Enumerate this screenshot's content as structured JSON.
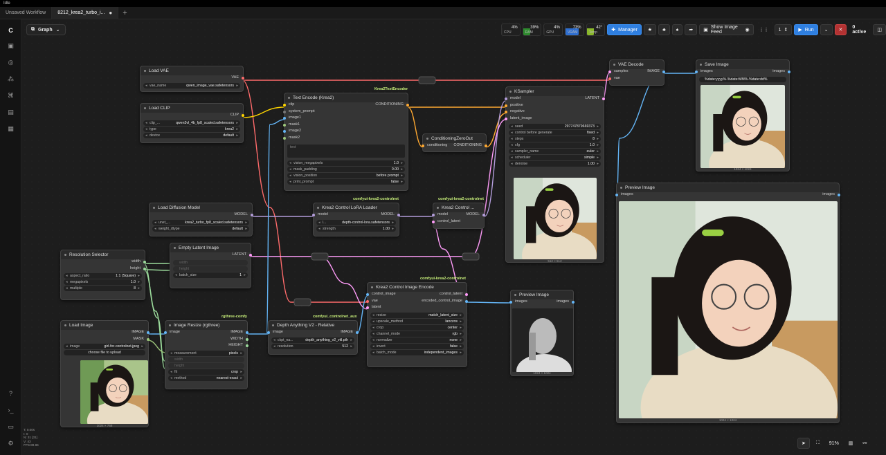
{
  "window": {
    "title": "Idle"
  },
  "tabs": [
    {
      "label": "Unsaved Workflow",
      "active": false
    },
    {
      "label": "8212_krea2_turbo_i...",
      "active": true
    }
  ],
  "tab_dot": "●",
  "tab_plus": "+",
  "canvas_mode": {
    "label": "Graph"
  },
  "stats": [
    {
      "label": "CPU",
      "value": "4%",
      "color": "#2a2a2a",
      "level": 0.04
    },
    {
      "label": "RAM",
      "value": "39%",
      "color": "#2e8b2e",
      "level": 0.39
    },
    {
      "label": "GPU",
      "value": "4%",
      "color": "#2a2a2a",
      "level": 0.04
    },
    {
      "label": "VRAM",
      "value": "73%",
      "color": "#2f6fd0",
      "level": 0.73
    },
    {
      "label": "Temp",
      "value": "42°",
      "color": "#8ab82a",
      "level": 0.42
    }
  ],
  "toolbar": {
    "manager": "Manager",
    "show_image_feed": "Show Image Feed",
    "queue_count": "1",
    "run": "Run",
    "active": "0 active"
  },
  "nodes": {
    "load_vae": {
      "title": "Load VAE",
      "out": "VAE",
      "w_vae_name_k": "vae_name",
      "w_vae_name_v": "qwen_image_vae.safetensors"
    },
    "load_clip": {
      "title": "Load CLIP",
      "out": "CLIP",
      "w1k": "clip_...",
      "w1v": "qwen3vl_4b_fp8_scaled.safetensors",
      "w2k": "type",
      "w2v": "krea2",
      "w3k": "device",
      "w3v": "default"
    },
    "text_encode": {
      "title": "Text Encode (Krea2)",
      "tag": "Krea2TextEncoder",
      "in": [
        "clip",
        "system_prompt",
        "image1",
        "mask1",
        "image2",
        "mask2"
      ],
      "out": "CONDITIONING",
      "text_ph": "text",
      "w": [
        [
          "vision_megapixels",
          "1.0"
        ],
        [
          "mask_padding",
          "0.00"
        ],
        [
          "vision_position",
          "before prompt"
        ],
        [
          "print_prompt",
          "false"
        ]
      ]
    },
    "cond_zero": {
      "title": "ConditioningZeroOut",
      "in": "conditioning",
      "out": "CONDITIONING"
    },
    "ksampler": {
      "title": "KSampler",
      "in": [
        "model",
        "positive",
        "negative",
        "latent_image"
      ],
      "out": "LATENT",
      "w": [
        [
          "seed",
          "297747879669373"
        ],
        [
          "control before generate",
          "fixed"
        ],
        [
          "steps",
          "8"
        ],
        [
          "cfg",
          "1.0"
        ],
        [
          "sampler_name",
          "euler"
        ],
        [
          "scheduler",
          "simple"
        ],
        [
          "denoise",
          "1.00"
        ]
      ],
      "caption": "512 × 512"
    },
    "vae_decode": {
      "title": "VAE Decode",
      "in": [
        "samples",
        "vae"
      ],
      "out": "IMAGE"
    },
    "save_image": {
      "title": "Save Image",
      "in": "images",
      "out": "images",
      "prefix": "%date:yyyy%-%date:MM%-%date:dd%",
      "caption": "1024 × 1024"
    },
    "preview_big": {
      "title": "Preview Image",
      "in": "images",
      "out": "images",
      "caption": "1024 × 1024"
    },
    "load_diffusion": {
      "title": "Load Diffusion Model",
      "out": "MODEL",
      "w1k": "unet_...",
      "w1v": "krea2_turbo_fp8_scaled.safetensors",
      "w2k": "weight_dtype",
      "w2v": "default"
    },
    "lora_loader": {
      "title": "Krea2 Control LoRA Loader",
      "tag": "comfyui-krea2-controlnet",
      "in": "model",
      "out": "MODEL",
      "w1k": "l...",
      "w1v": "depth-control-lora.safetensors",
      "w2k": "strength",
      "w2v": "1.00"
    },
    "krea2_control": {
      "title": "Krea2 Control ...",
      "tag": "comfyui-krea2-controlnet",
      "in": [
        "model",
        "control_latent"
      ],
      "out": "MODEL"
    },
    "resolution": {
      "title": "Resolution Selector",
      "out": [
        "width",
        "height"
      ],
      "w": [
        [
          "aspect_ratio",
          "1:1 (Square)"
        ],
        [
          "megapixels",
          "1.0"
        ],
        [
          "multiple",
          "8"
        ]
      ]
    },
    "empty_latent": {
      "title": "Empty Latent Image",
      "out": "LATENT",
      "w": [
        [
          "width",
          ""
        ],
        [
          "height",
          ""
        ],
        [
          "batch_size",
          "1"
        ]
      ]
    },
    "load_image": {
      "title": "Load Image",
      "out": [
        "IMAGE",
        "MASK"
      ],
      "wk": "image",
      "wv": "girl-for-controlnet.jpeg",
      "upload": "choose file to upload",
      "caption": "1024 × 768"
    },
    "image_resize": {
      "title": "Image Resize (rgthree)",
      "tag": "rgthree-comfy",
      "in": "image",
      "out": [
        "IMAGE",
        "WIDTH",
        "HEIGHT"
      ],
      "w": [
        [
          "measurement",
          "pixels"
        ],
        [
          "width",
          ""
        ],
        [
          "height",
          ""
        ],
        [
          "fit",
          "crop"
        ],
        [
          "method",
          "nearest-exact"
        ]
      ]
    },
    "depth_anything": {
      "title": "Depth Anything V2 - Relative",
      "tag": "comfyui_controlnet_aux",
      "in": "image",
      "out": "IMAGE",
      "w1k": "ckpt_na...",
      "w1v": "depth_anything_v2_vitl.pth",
      "w2k": "resolution",
      "w2v": "512"
    },
    "control_encode": {
      "title": "Krea2 Control Image Encode",
      "tag": "comfyui-krea2-controlnet",
      "in": [
        "control_image",
        "vae",
        "latent"
      ],
      "out": [
        "control_latent",
        "encoded_control_image"
      ],
      "w": [
        [
          "resize",
          "match_latent_size"
        ],
        [
          "upscale_method",
          "lanczos"
        ],
        [
          "crop",
          "center"
        ],
        [
          "channel_mode",
          "rgb"
        ],
        [
          "normalize",
          "none"
        ],
        [
          "invert",
          "false"
        ],
        [
          "batch_mode",
          "independent_images"
        ]
      ]
    },
    "preview_small": {
      "title": "Preview Image",
      "in": "images",
      "out": "images",
      "caption": "1024 × 1024"
    }
  },
  "debug": [
    "T: 0.00s",
    "I: 0",
    "N: 31 [31]",
    "V: 43",
    "FPS:89.86"
  ],
  "zoom": "91%",
  "colors": {
    "vae": "#ff6b6b",
    "clip": "#ffd500",
    "cond": "#ffa931",
    "model": "#b39ddb",
    "latent": "#ff9cf9",
    "image": "#64b5f6",
    "int": "#9cdb9c"
  }
}
